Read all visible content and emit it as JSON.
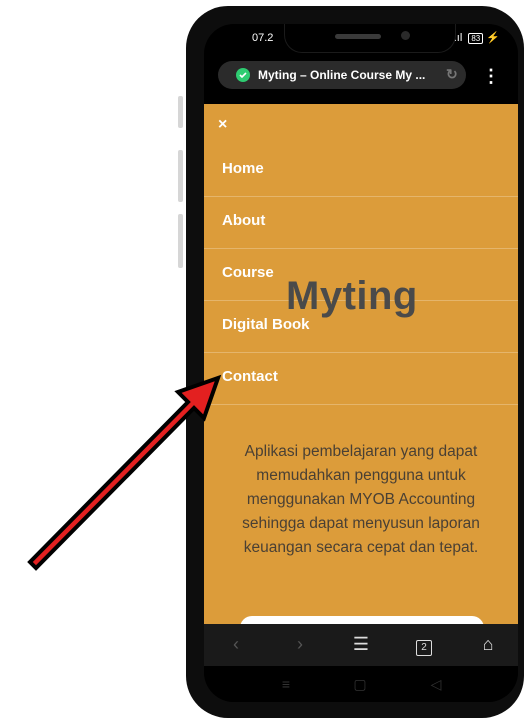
{
  "status_bar": {
    "time": "07.2",
    "indicators": ".ıl",
    "battery": "83"
  },
  "browser": {
    "tab_title": "Myting – Online Course My ...",
    "menu_icon": "kebab-icon"
  },
  "menu": {
    "close_label": "×",
    "items": [
      {
        "label": "Home"
      },
      {
        "label": "About"
      },
      {
        "label": "Course"
      },
      {
        "label": "Digital Book"
      },
      {
        "label": "Contact"
      }
    ]
  },
  "hero": {
    "brand": "Myting",
    "description": "Aplikasi pembelajaran yang dapat memudahkan pengguna untuk menggunakan MYOB Accounting sehingga dapat menyusun laporan keuangan secara cepat dan tepat."
  },
  "bottom_nav": {
    "tab_count": "2"
  },
  "colors": {
    "page_bg": "#dc9c3a",
    "arrow": "#e32020",
    "text_dark": "#4a4a4a"
  }
}
